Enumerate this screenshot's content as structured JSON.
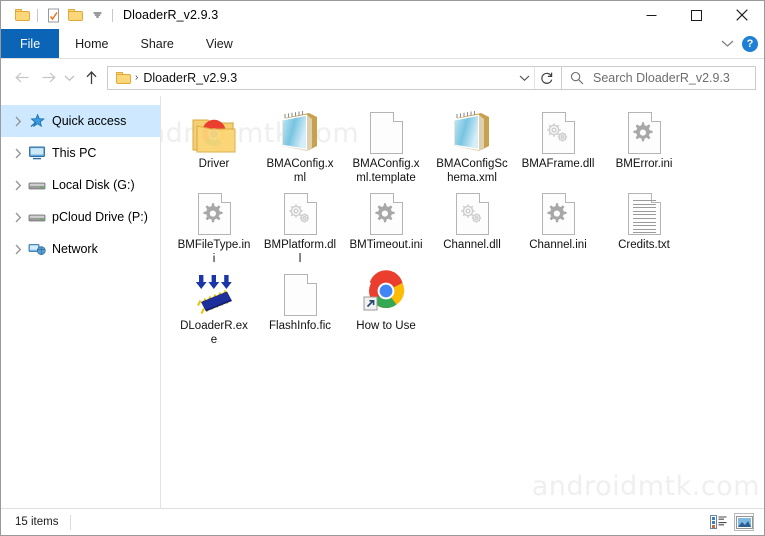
{
  "window": {
    "title": "DloaderR_v2.9.3",
    "quick_access_toolbar": [
      {
        "name": "folder-icon",
        "label": "Restore / folder"
      },
      {
        "name": "properties-icon",
        "label": "Properties"
      },
      {
        "name": "new-folder-icon",
        "label": "New folder"
      },
      {
        "name": "customize-dropdown-icon",
        "label": "Customize Quick Access Toolbar"
      }
    ],
    "controls": {
      "minimize": "—",
      "maximize": "□",
      "close": "✕"
    }
  },
  "ribbon": {
    "tabs": [
      {
        "label": "File",
        "selected": true
      },
      {
        "label": "Home",
        "selected": false
      },
      {
        "label": "Share",
        "selected": false
      },
      {
        "label": "View",
        "selected": false
      }
    ],
    "expand_label": "⌄",
    "help_label": "?"
  },
  "navigation": {
    "back_label": "Back",
    "forward_label": "Forward",
    "recent_label": "Recent locations",
    "up_label": "Up",
    "breadcrumb": "DloaderR_v2.9.3",
    "breadcrumb_separator": "›",
    "dropdown_label": "Previous locations",
    "refresh_label": "Refresh"
  },
  "search": {
    "placeholder": "Search DloaderR_v2.9.3"
  },
  "sidebar": {
    "items": [
      {
        "label": "Quick access",
        "icon": "star-icon",
        "selected": true
      },
      {
        "label": "This PC",
        "icon": "monitor-icon",
        "selected": false
      },
      {
        "label": "Local Disk (G:)",
        "icon": "drive-icon",
        "selected": false
      },
      {
        "label": "pCloud Drive (P:)",
        "icon": "drive-icon",
        "selected": false
      },
      {
        "label": "Network",
        "icon": "network-icon",
        "selected": false
      }
    ]
  },
  "files": [
    {
      "name": "Driver",
      "type": "folder-chrome"
    },
    {
      "name": "BMAConfig.xml",
      "type": "xml"
    },
    {
      "name": "BMAConfig.xml.template",
      "type": "blank"
    },
    {
      "name": "BMAConfigSchema.xml",
      "type": "xml"
    },
    {
      "name": "BMAFrame.dll",
      "type": "dll"
    },
    {
      "name": "BMError.ini",
      "type": "ini"
    },
    {
      "name": "BMFileType.ini",
      "type": "ini"
    },
    {
      "name": "BMPlatform.dll",
      "type": "dll"
    },
    {
      "name": "BMTimeout.ini",
      "type": "ini"
    },
    {
      "name": "Channel.dll",
      "type": "dll"
    },
    {
      "name": "Channel.ini",
      "type": "ini"
    },
    {
      "name": "Credits.txt",
      "type": "txt"
    },
    {
      "name": "DLoaderR.exe",
      "type": "exe-chip"
    },
    {
      "name": "FlashInfo.fic",
      "type": "blank"
    },
    {
      "name": "How to Use",
      "type": "chrome-shortcut"
    }
  ],
  "watermark": {
    "text": "androidmtk.com"
  },
  "status": {
    "item_count": "15 items",
    "view_buttons": [
      {
        "name": "details-view-button",
        "active": false
      },
      {
        "name": "large-icons-view-button",
        "active": true
      }
    ]
  }
}
